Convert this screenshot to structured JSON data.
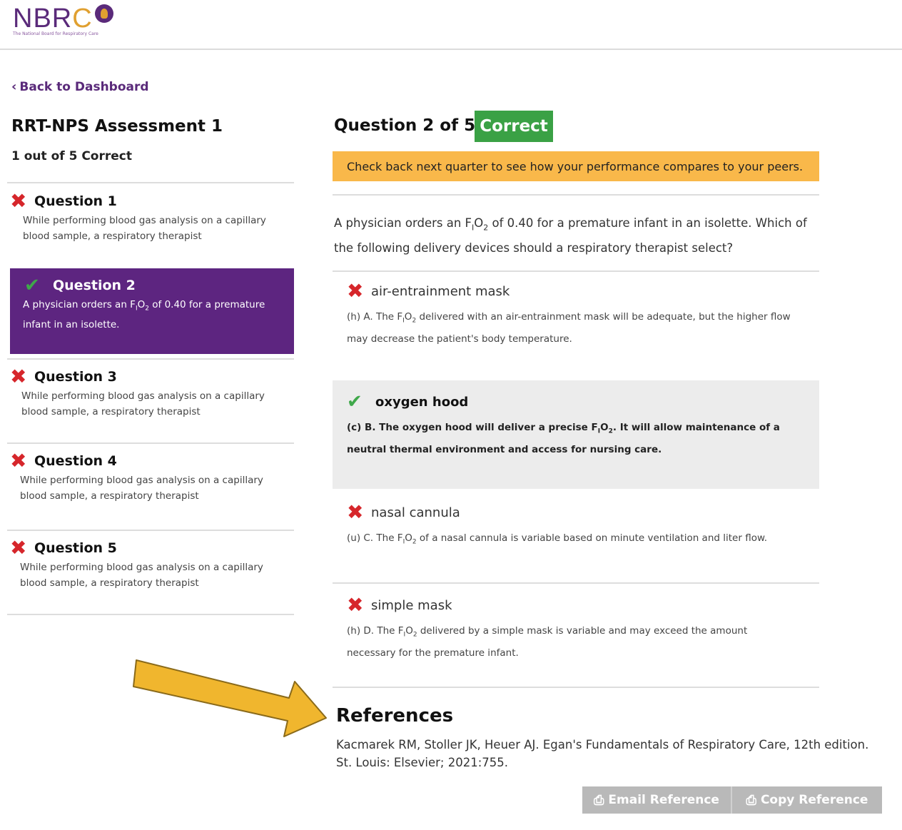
{
  "header": {
    "logo_text_main": "NBR",
    "logo_text_c": "C",
    "logo_tagline": "The National Board for Respiratory Care"
  },
  "nav": {
    "back_label": "Back to Dashboard"
  },
  "assessment": {
    "title": "RRT-NPS Assessment 1",
    "score": "1 out of 5 Correct"
  },
  "questions": [
    {
      "label": "Question 1",
      "status": "incorrect",
      "preview": "While performing blood gas analysis on a capillary blood sample, a respiratory therapist"
    },
    {
      "label": "Question 2",
      "status": "correct",
      "preview_a": "A physician orders an F",
      "preview_sub1": "I",
      "preview_b": "O",
      "preview_sub2": "2",
      "preview_c": " of 0.40 for a premature infant in an isolette."
    },
    {
      "label": "Question 3",
      "status": "incorrect",
      "preview": "While performing blood gas analysis on a capillary blood sample, a respiratory therapist"
    },
    {
      "label": "Question 4",
      "status": "incorrect",
      "preview": "While performing blood gas analysis on a capillary blood sample, a respiratory therapist"
    },
    {
      "label": "Question 5",
      "status": "incorrect",
      "preview": "While performing blood gas analysis on a capillary blood sample, a respiratory therapist"
    }
  ],
  "detail": {
    "title": "Question 2 of 5 :",
    "result_badge": "Correct",
    "banner": "Check back next quarter to see how your performance compares to your peers.",
    "stem_a": "A physician orders an F",
    "stem_sub1": "I",
    "stem_b": "O",
    "stem_sub2": "2",
    "stem_c": " of 0.40 for a premature infant in an isolette.  Which of the following delivery devices should a respiratory therapist select?",
    "options": [
      {
        "label": "air-entrainment mask",
        "status": "incorrect",
        "exp_a": "(h) A. The F",
        "exp_sub1": "I",
        "exp_b": "O",
        "exp_sub2": "2",
        "exp_c": " delivered with an air-entrainment mask will be adequate, but the higher flow may decrease the patient's body temperature."
      },
      {
        "label": "oxygen hood",
        "status": "correct",
        "exp_a": "(c) B. The oxygen hood will deliver a precise F",
        "exp_sub1": "I",
        "exp_b": "O",
        "exp_sub2": "2",
        "exp_c": ". It will allow maintenance of a neutral thermal environment and access for nursing care."
      },
      {
        "label": "nasal cannula",
        "status": "incorrect",
        "exp_a": "(u) C. The F",
        "exp_sub1": "I",
        "exp_b": "O",
        "exp_sub2": "2",
        "exp_c": " of a nasal cannula is variable based on minute ventilation and liter flow."
      },
      {
        "label": "simple mask",
        "status": "incorrect",
        "exp_a": "(h) D. The F",
        "exp_sub1": "I",
        "exp_b": "O",
        "exp_sub2": "2",
        "exp_c": " delivered by a simple mask is variable and may exceed the amount necessary for the premature infant."
      }
    ]
  },
  "references": {
    "title": "References",
    "text": "Kacmarek RM, Stoller JK, Heuer AJ. Egan's Fundamentals of Respiratory Care, 12th edition. St. Louis: Elsevier; 2021:755."
  },
  "actions": {
    "email_label": "Email Reference",
    "copy_label": "Copy Reference"
  },
  "colors": {
    "brand_purple": "#5d2580",
    "correct_green": "#3aa145",
    "incorrect_red": "#d6262b",
    "banner_orange": "#f9b84a",
    "arrow_gold": "#f0b62e"
  },
  "icons": {
    "back": "chevron-left-icon",
    "incorrect": "x-icon",
    "correct": "checkmark-icon",
    "print": "printer-icon",
    "annotation": "arrow-icon"
  }
}
